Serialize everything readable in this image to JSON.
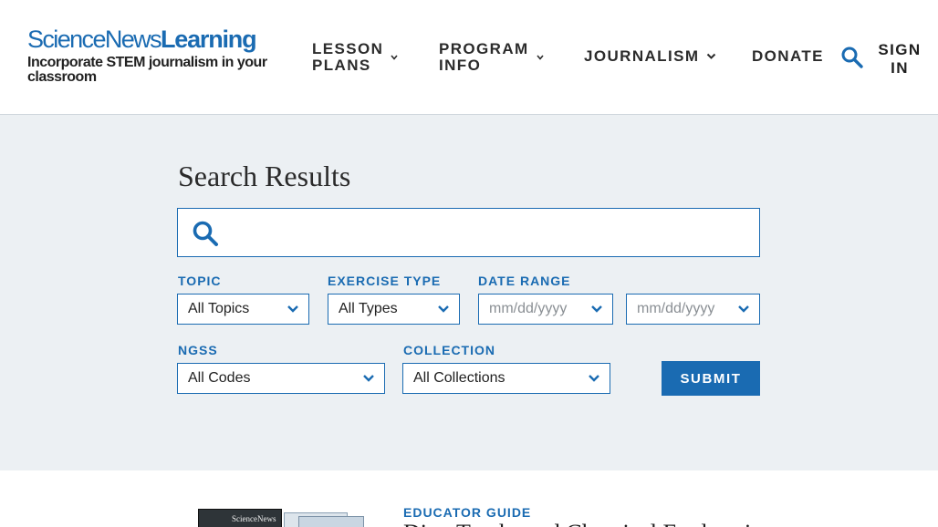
{
  "header": {
    "logo_primary": "ScienceNews",
    "logo_secondary": "Learning",
    "logo_tagline": "Incorporate STEM journalism in your classroom",
    "nav": [
      {
        "label": "LESSON\nPLANS",
        "has_dropdown": true
      },
      {
        "label": "PROGRAM\nINFO",
        "has_dropdown": true
      },
      {
        "label": "JOURNALISM",
        "has_dropdown": true
      },
      {
        "label": "DONATE",
        "has_dropdown": false
      }
    ],
    "search_icon": "search-icon",
    "signin_label": "SIGN\nIN"
  },
  "search": {
    "title": "Search Results",
    "query_value": "",
    "filters": {
      "topic": {
        "label": "TOPIC",
        "value": "All Topics"
      },
      "exercise_type": {
        "label": "EXERCISE TYPE",
        "value": "All Types"
      },
      "date_range": {
        "label": "DATE RANGE",
        "start_placeholder": "mm/dd/yyyy",
        "end_placeholder": "mm/dd/yyyy"
      },
      "ngss": {
        "label": "NGSS",
        "value": "All Codes"
      },
      "collection": {
        "label": "COLLECTION",
        "value": "All Collections"
      }
    },
    "submit_label": "SUBMIT"
  },
  "results": [
    {
      "type": "EDUCATOR GUIDE",
      "title": "Dino Tracks and Chemical Exploration",
      "thumb_masthead": "ScienceNews"
    }
  ],
  "colors": {
    "brand_blue": "#1a6bb2",
    "panel_bg": "#ecf0f3"
  }
}
